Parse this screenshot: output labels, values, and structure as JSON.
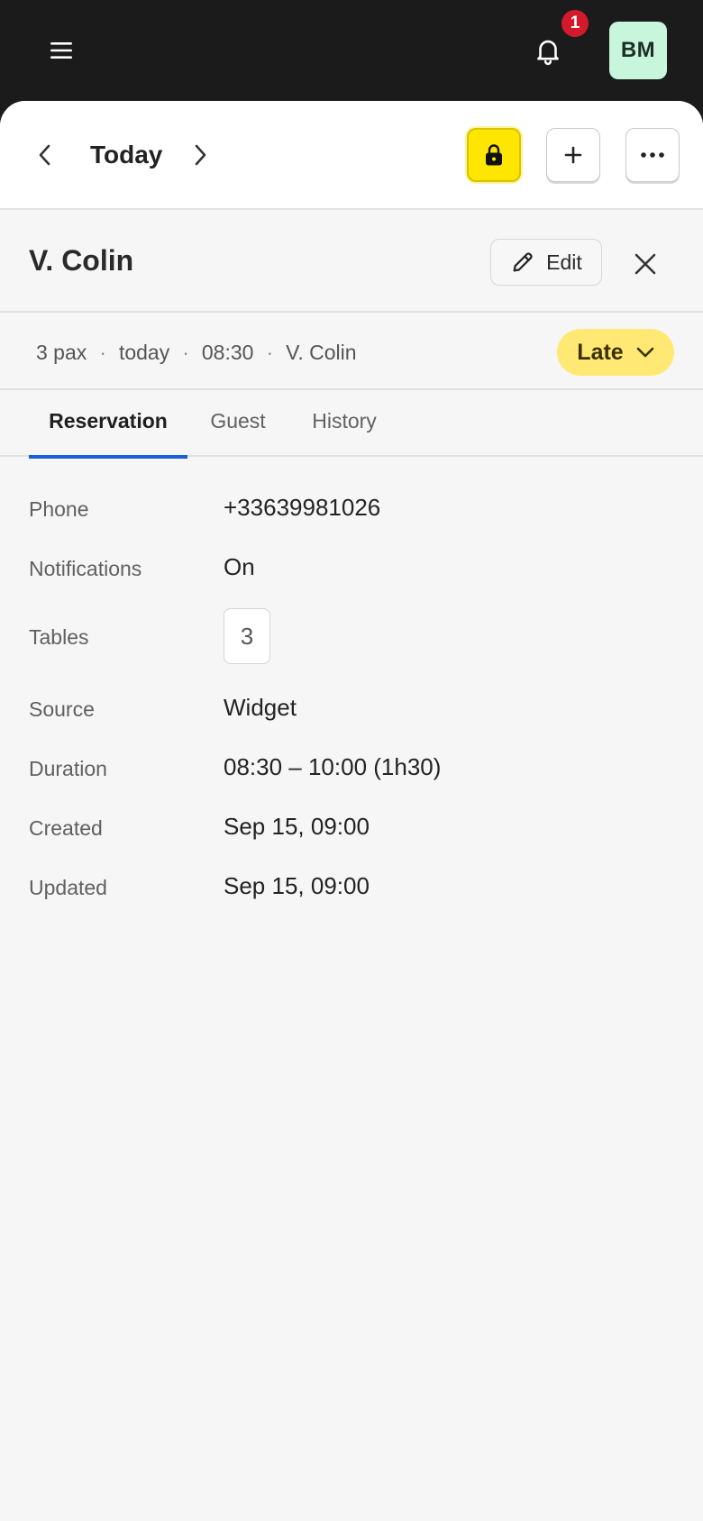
{
  "topbar": {
    "menu_icon": "hamburger-icon",
    "bell_icon": "bell-icon",
    "notification_count": "1",
    "avatar_initials": "BM",
    "avatar_color": "#c7f6dc"
  },
  "date_nav": {
    "prev_icon": "chevron-left-icon",
    "title": "Today",
    "next_icon": "chevron-right-icon",
    "lock_icon": "lock-icon",
    "lock_color": "#ffe600",
    "add_icon": "plus-icon",
    "more_icon": "more-horizontal-icon"
  },
  "reservation": {
    "guest_name": "V. Colin",
    "edit_label": "Edit",
    "summary": {
      "pax": "3 pax",
      "day": "today",
      "time": "08:30",
      "guest": "V. Colin",
      "separator": "·"
    },
    "status": {
      "label": "Late",
      "color": "#ffe873"
    }
  },
  "tabs": [
    {
      "label": "Reservation",
      "active": true
    },
    {
      "label": "Guest",
      "active": false
    },
    {
      "label": "History",
      "active": false
    }
  ],
  "accent_color": "#1a5fd6",
  "details": {
    "phone": {
      "label": "Phone",
      "value": "+33639981026"
    },
    "notifications": {
      "label": "Notifications",
      "value": "On"
    },
    "tables": {
      "label": "Tables",
      "value": "3"
    },
    "source": {
      "label": "Source",
      "value": "Widget"
    },
    "duration": {
      "label": "Duration",
      "value": "08:30 – 10:00 (1h30)"
    },
    "created": {
      "label": "Created",
      "value": "Sep 15, 09:00"
    },
    "updated": {
      "label": "Updated",
      "value": "Sep 15, 09:00"
    }
  }
}
